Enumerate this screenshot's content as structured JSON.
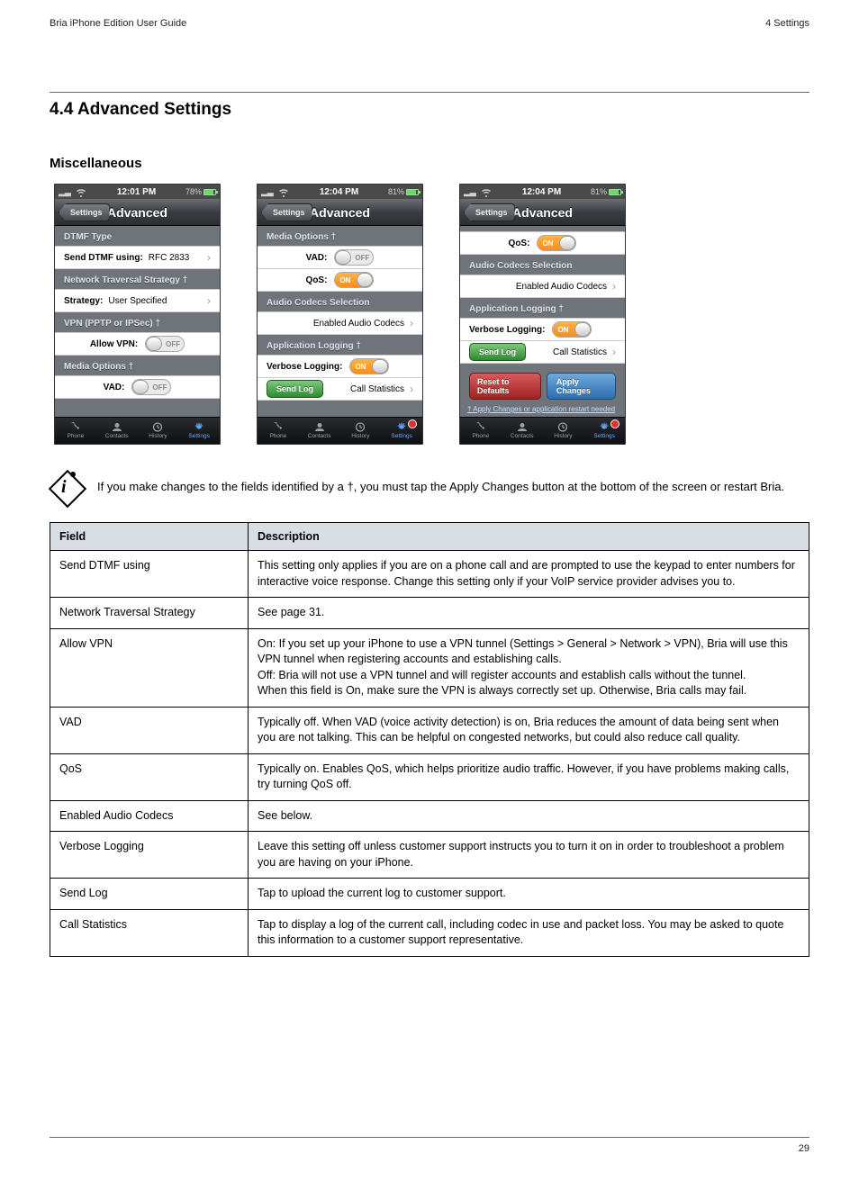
{
  "header": {
    "left": "Bria iPhone Edition User Guide",
    "right": "4 Settings"
  },
  "section_title": "4.4  Advanced Settings",
  "subsection_title": "Miscellaneous",
  "note_text": "If you make changes to the fields identified by a †, you must tap the Apply Changes button at the bottom of the screen or restart Bria.",
  "shot1": {
    "time": "12:01 PM",
    "battery": "78%",
    "back": "Settings",
    "title": "Advanced",
    "grp1": "DTMF Type",
    "r1_lbl": "Send DTMF using:",
    "r1_val": "RFC 2833",
    "grp2": "Network Traversal Strategy †",
    "r2_lbl": "Strategy:",
    "r2_val": "User Specified",
    "grp3": "VPN (PPTP or IPSec) †",
    "r3_lbl": "Allow VPN:",
    "r3_off": "OFF",
    "grp4": "Media Options †",
    "r4_lbl": "VAD:",
    "r4_off": "OFF"
  },
  "shot2": {
    "time": "12:04 PM",
    "battery": "81%",
    "back": "Settings",
    "title": "Advanced",
    "grp1": "Media Options †",
    "r1_lbl": "VAD:",
    "r1_off": "OFF",
    "r2_lbl": "QoS:",
    "r2_on": "ON",
    "grp2": "Audio Codecs Selection",
    "r3_txt": "Enabled Audio Codecs",
    "grp3": "Application Logging †",
    "r4_lbl": "Verbose Logging:",
    "r4_on": "ON",
    "r5_btn": "Send Log",
    "r5_txt": "Call Statistics"
  },
  "shot3": {
    "time": "12:04 PM",
    "battery": "81%",
    "back": "Settings",
    "title": "Advanced",
    "r1_lbl": "QoS:",
    "r1_on": "ON",
    "grp2": "Audio Codecs Selection",
    "r2_txt": "Enabled Audio Codecs",
    "grp3": "Application Logging †",
    "r3_lbl": "Verbose Logging:",
    "r3_on": "ON",
    "r4_btn": "Send Log",
    "r4_txt": "Call Statistics",
    "btn_reset": "Reset to Defaults",
    "btn_apply": "Apply Changes",
    "footnote": "† Apply Changes or application restart needed"
  },
  "tabs": {
    "phone": "Phone",
    "contacts": "Contacts",
    "history": "History",
    "settings": "Settings"
  },
  "table": {
    "h1": "Field",
    "h2": "Description",
    "rows": [
      {
        "f": "Send DTMF using",
        "d": "This setting only applies if you are on a phone call and are prompted to use the keypad to enter numbers for interactive voice response. Change this setting only if your VoIP service provider advises you to."
      },
      {
        "f": "Network Traversal Strategy",
        "d": "See page 31."
      },
      {
        "f": "Allow VPN",
        "d": "On: If you set up your iPhone to use a VPN tunnel (Settings > General > Network > VPN), Bria will use this VPN tunnel when registering accounts and establishing calls.\nOff: Bria will not use a VPN tunnel and will register accounts and establish calls without the tunnel.\nWhen this field is On, make sure the VPN is always correctly set up. Otherwise, Bria calls may fail."
      },
      {
        "f": "VAD",
        "d": "Typically off. When VAD (voice activity detection) is on, Bria reduces the amount of data being sent when you are not talking. This can be helpful on congested networks, but could also reduce call quality."
      },
      {
        "f": "QoS",
        "d": "Typically on. Enables QoS, which helps prioritize audio traffic. However, if you have problems making calls, try turning QoS off."
      },
      {
        "f": "Enabled Audio Codecs",
        "d": "See below."
      },
      {
        "f": "Verbose Logging",
        "d": "Leave this setting off unless customer support instructs you to turn it on in order to troubleshoot a problem you are having on your iPhone."
      },
      {
        "f": "Send Log",
        "d": "Tap to upload the current log to customer support."
      },
      {
        "f": "Call Statistics",
        "d": "Tap to display a log of the current call, including codec in use and packet loss. You may be asked to quote this information to a customer support representative."
      }
    ]
  },
  "footer": {
    "page": "29"
  }
}
